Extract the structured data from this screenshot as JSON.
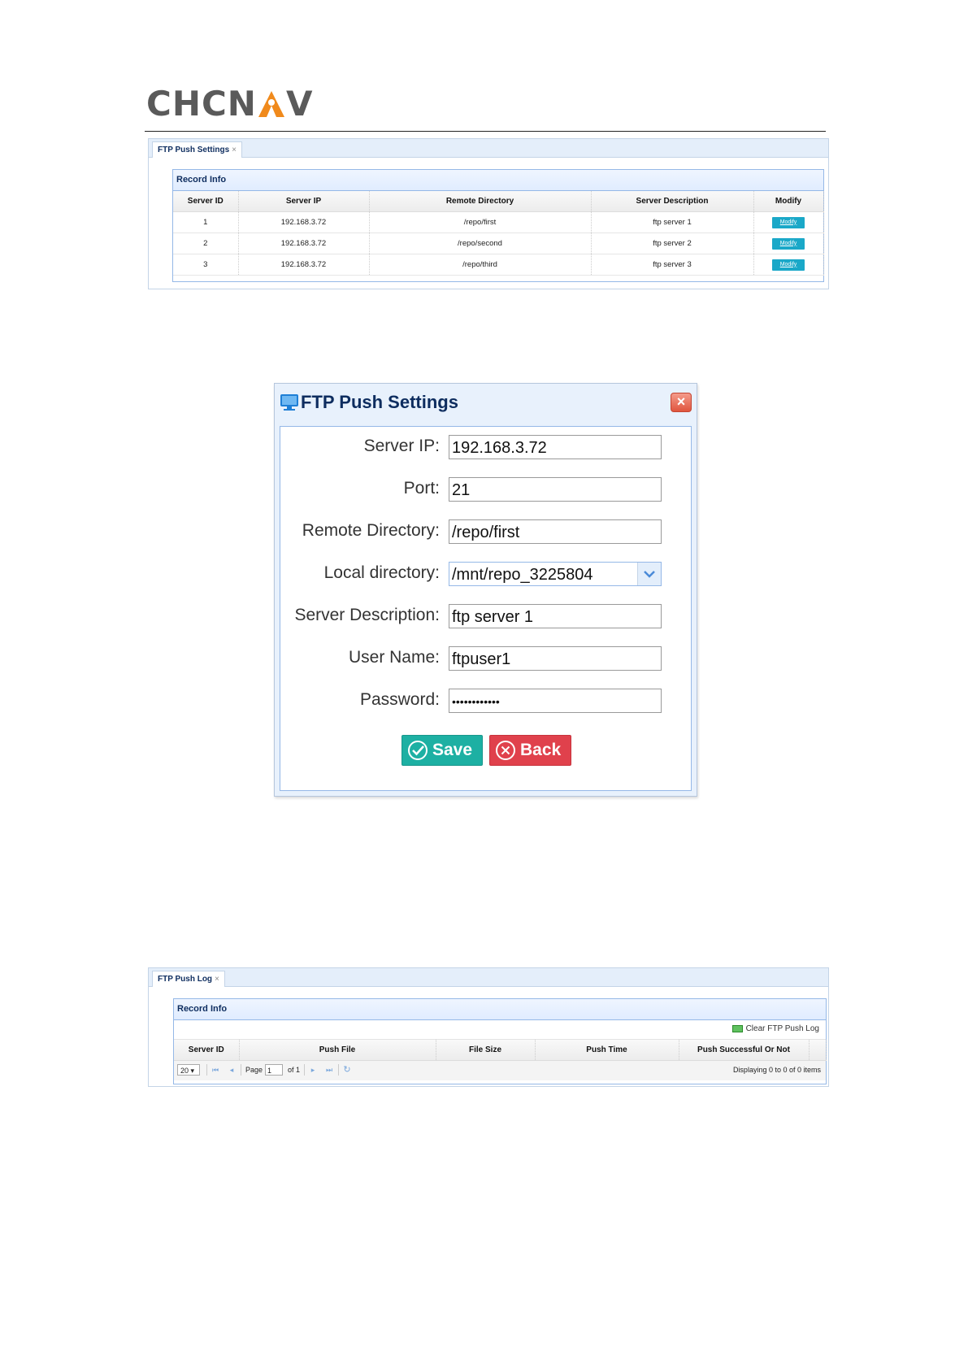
{
  "logo": {
    "text_left": "CHCN",
    "text_right": "V"
  },
  "settings_panel": {
    "tab_label": "FTP Push Settings",
    "tab_close": "×",
    "grid_title": "Record Info",
    "columns": [
      "Server ID",
      "Server IP",
      "Remote Directory",
      "Server Description",
      "Modify"
    ],
    "rows": [
      {
        "id": "1",
        "ip": "192.168.3.72",
        "dir": "/repo/first",
        "desc": "ftp server 1",
        "action": "Modify"
      },
      {
        "id": "2",
        "ip": "192.168.3.72",
        "dir": "/repo/second",
        "desc": "ftp server 2",
        "action": "Modify"
      },
      {
        "id": "3",
        "ip": "192.168.3.72",
        "dir": "/repo/third",
        "desc": "ftp server 3",
        "action": "Modify"
      }
    ]
  },
  "dialog": {
    "title": "FTP Push Settings",
    "close": "×",
    "fields": {
      "server_ip": {
        "label": "Server IP:",
        "value": "192.168.3.72"
      },
      "port": {
        "label": "Port:",
        "value": "21"
      },
      "remote_dir": {
        "label": "Remote Directory:",
        "value": "/repo/first"
      },
      "local_dir": {
        "label": "Local directory:",
        "value": "/mnt/repo_3225804"
      },
      "server_desc": {
        "label": "Server Description:",
        "value": "ftp server 1"
      },
      "user_name": {
        "label": "User Name:",
        "value": "ftpuser1"
      },
      "password": {
        "label": "Password:",
        "value": "••••••••••••"
      }
    },
    "save_label": "Save",
    "back_label": "Back"
  },
  "log_panel": {
    "tab_label": "FTP Push Log",
    "tab_close": "×",
    "grid_title": "Record Info",
    "clear_label": "Clear FTP Push Log",
    "columns": [
      "Server ID",
      "Push File",
      "File Size",
      "Push Time",
      "Push Successful Or Not"
    ],
    "pager": {
      "page_size": "20",
      "page_label": "Page",
      "page_value": "1",
      "of_label": "of 1",
      "display_text": "Displaying 0 to 0 of 0 items"
    }
  },
  "colors": {
    "accent_teal": "#1aa8c8",
    "save": "#1db0a3",
    "back": "#e0414c",
    "header_blue": "#0e2d5f",
    "logo_orange": "#f08a1c"
  }
}
